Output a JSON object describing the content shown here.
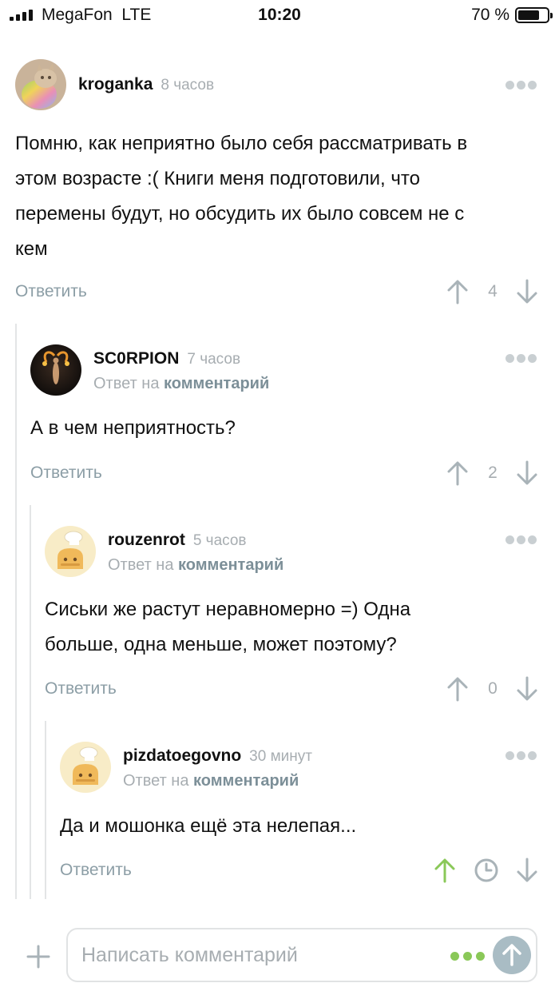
{
  "status_bar": {
    "carrier": "MegaFon",
    "network": "LTE",
    "time": "10:20",
    "battery": "70 %",
    "battery_level": 0.7
  },
  "comments": [
    {
      "username": "kroganka",
      "time": "8 часов",
      "text": [
        "Помню, как неприятно было себя рассматривать в",
        "этом возрасте :( Книги меня подготовили, что",
        "перемены будут, но обсудить их было совсем не с",
        "кем"
      ],
      "reply_label": "Ответить",
      "rating": "4",
      "avatar": "cat-avatar"
    },
    {
      "username": "SC0RPION",
      "time": "7 часов",
      "reply_to_prefix": "Ответ на",
      "reply_to_link": "комментарий",
      "text": [
        "А в чем неприятность?"
      ],
      "reply_label": "Ответить",
      "rating": "2",
      "avatar": "fire-figure-avatar"
    },
    {
      "username": "rouzenrot",
      "time": "5 часов",
      "reply_to_prefix": "Ответ на",
      "reply_to_link": "комментарий",
      "text": [
        "Сиськи же растут неравномерно =) Одна",
        "больше, одна меньше, может поэтому?"
      ],
      "reply_label": "Ответить",
      "rating": "0",
      "avatar": "chef-bread-avatar"
    },
    {
      "username": "pizdatoegovno",
      "time": "30 минут",
      "reply_to_prefix": "Ответ на",
      "reply_to_link": "комментарий",
      "text": [
        "Да и мошонка ещё эта нелепая..."
      ],
      "reply_label": "Ответить",
      "rating_icon": "clock-icon",
      "upvoted": true,
      "avatar": "chef-bread-avatar"
    }
  ],
  "composer": {
    "placeholder": "Написать комментарий"
  },
  "colors": {
    "accent_green": "#8ac858",
    "muted": "#a7adb1",
    "link": "#7c8f98",
    "send": "#a9bcc4"
  }
}
